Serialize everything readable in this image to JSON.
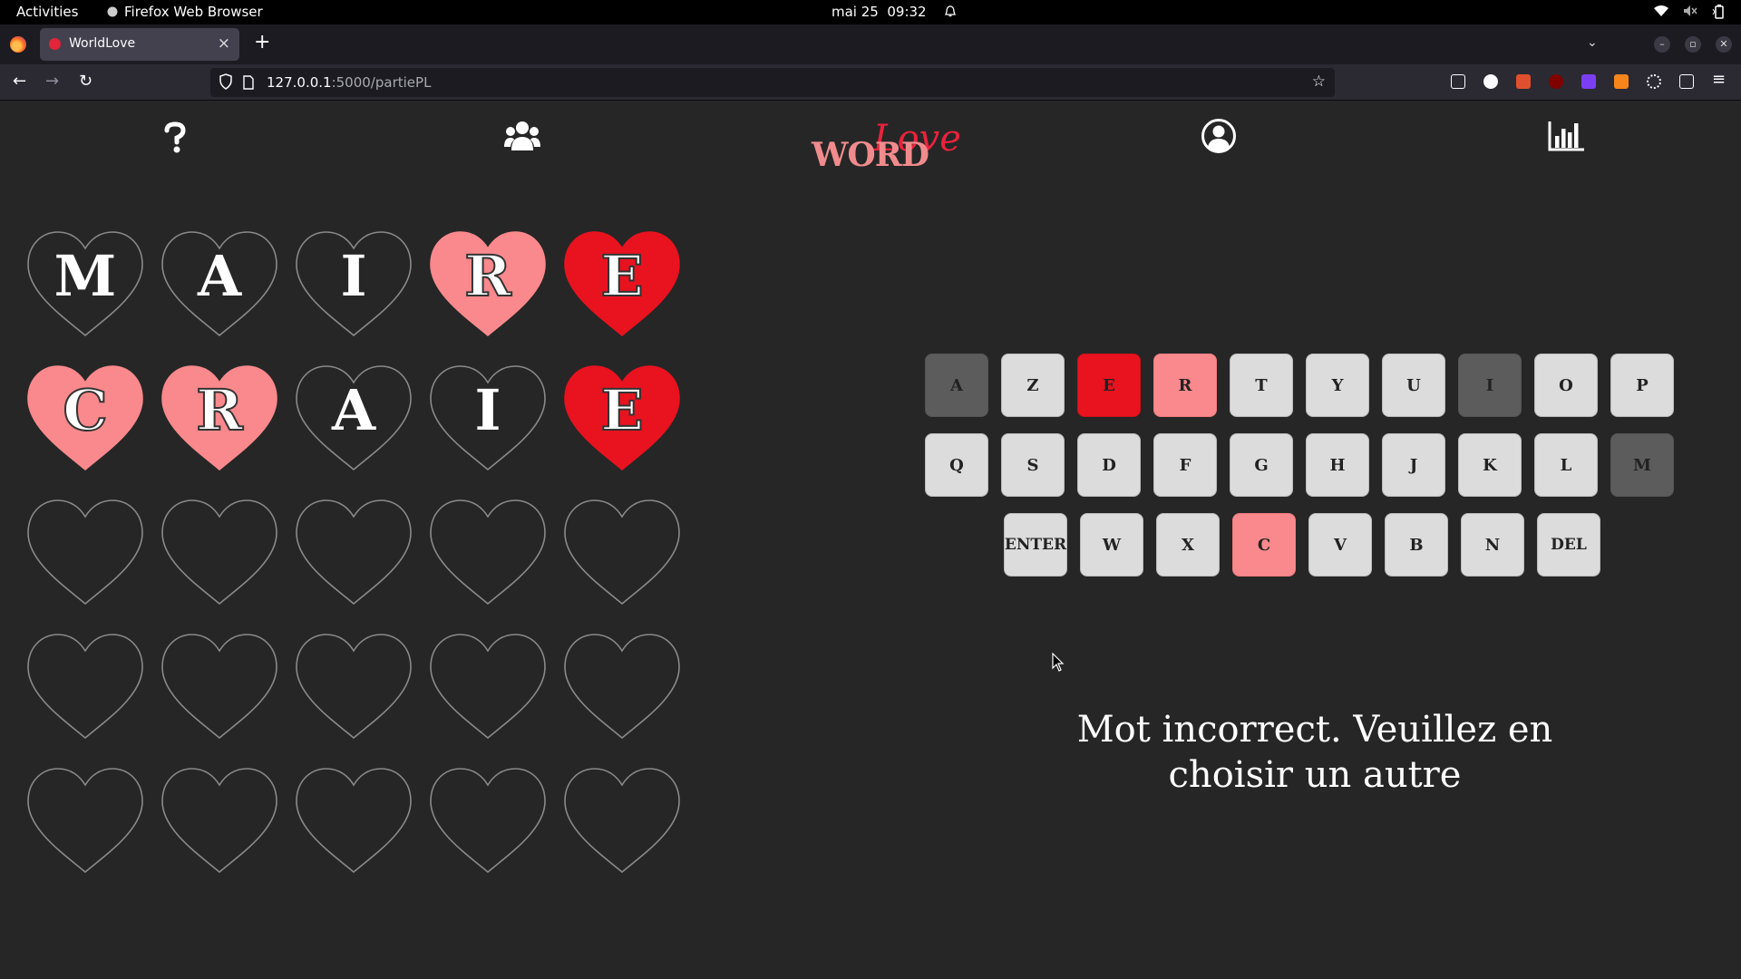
{
  "system_bar": {
    "activities": "Activities",
    "app_name": "Firefox Web Browser",
    "date": "mai 25",
    "time": "09:32"
  },
  "browser": {
    "tab_title": "WorldLove",
    "url_host": "127.0.0.1",
    "url_path": ":5000/partiePL"
  },
  "app": {
    "logo_word": "WORD",
    "logo_love": "Love",
    "header_icons": [
      "help-icon",
      "users-icon",
      "account-icon",
      "stats-icon"
    ]
  },
  "colors": {
    "present": "#f9898c",
    "correct": "#e8131f",
    "absent": "#5c5c5c",
    "neutral": "#dcdcdc",
    "outline": "#8a8a8a"
  },
  "board": {
    "rows": [
      [
        {
          "l": "M",
          "s": "empty"
        },
        {
          "l": "A",
          "s": "empty"
        },
        {
          "l": "I",
          "s": "empty"
        },
        {
          "l": "R",
          "s": "present"
        },
        {
          "l": "E",
          "s": "correct"
        }
      ],
      [
        {
          "l": "C",
          "s": "present"
        },
        {
          "l": "R",
          "s": "present"
        },
        {
          "l": "A",
          "s": "empty"
        },
        {
          "l": "I",
          "s": "empty"
        },
        {
          "l": "E",
          "s": "correct"
        }
      ],
      [
        {
          "l": "",
          "s": "empty"
        },
        {
          "l": "",
          "s": "empty"
        },
        {
          "l": "",
          "s": "empty"
        },
        {
          "l": "",
          "s": "empty"
        },
        {
          "l": "",
          "s": "empty"
        }
      ],
      [
        {
          "l": "",
          "s": "empty"
        },
        {
          "l": "",
          "s": "empty"
        },
        {
          "l": "",
          "s": "empty"
        },
        {
          "l": "",
          "s": "empty"
        },
        {
          "l": "",
          "s": "empty"
        }
      ],
      [
        {
          "l": "",
          "s": "empty"
        },
        {
          "l": "",
          "s": "empty"
        },
        {
          "l": "",
          "s": "empty"
        },
        {
          "l": "",
          "s": "empty"
        },
        {
          "l": "",
          "s": "empty"
        }
      ]
    ]
  },
  "keyboard": {
    "rows": [
      [
        {
          "k": "A",
          "s": "absent"
        },
        {
          "k": "Z",
          "s": "neutral"
        },
        {
          "k": "E",
          "s": "correct"
        },
        {
          "k": "R",
          "s": "present"
        },
        {
          "k": "T",
          "s": "neutral"
        },
        {
          "k": "Y",
          "s": "neutral"
        },
        {
          "k": "U",
          "s": "neutral"
        },
        {
          "k": "I",
          "s": "absent"
        },
        {
          "k": "O",
          "s": "neutral"
        },
        {
          "k": "P",
          "s": "neutral"
        }
      ],
      [
        {
          "k": "Q",
          "s": "neutral"
        },
        {
          "k": "S",
          "s": "neutral"
        },
        {
          "k": "D",
          "s": "neutral"
        },
        {
          "k": "F",
          "s": "neutral"
        },
        {
          "k": "G",
          "s": "neutral"
        },
        {
          "k": "H",
          "s": "neutral"
        },
        {
          "k": "J",
          "s": "neutral"
        },
        {
          "k": "K",
          "s": "neutral"
        },
        {
          "k": "L",
          "s": "neutral"
        },
        {
          "k": "M",
          "s": "absent"
        }
      ],
      [
        {
          "k": "ENTER",
          "s": "neutral"
        },
        {
          "k": "W",
          "s": "neutral"
        },
        {
          "k": "X",
          "s": "neutral"
        },
        {
          "k": "C",
          "s": "present"
        },
        {
          "k": "V",
          "s": "neutral"
        },
        {
          "k": "B",
          "s": "neutral"
        },
        {
          "k": "N",
          "s": "neutral"
        },
        {
          "k": "DEL",
          "s": "neutral"
        }
      ]
    ]
  },
  "message": {
    "line1": "Mot incorrect. Veuillez en",
    "line2": "choisir un autre"
  }
}
